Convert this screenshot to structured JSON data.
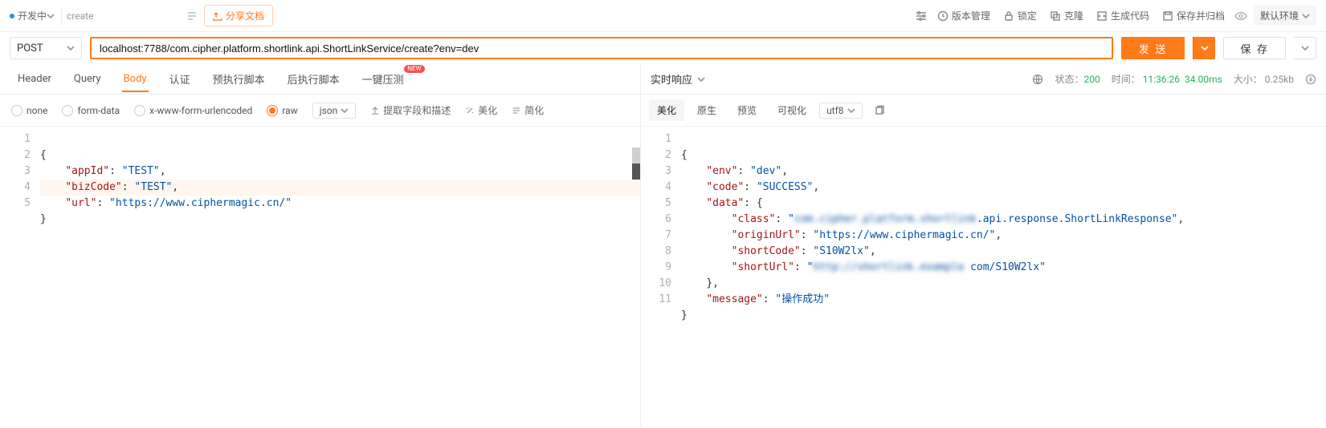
{
  "topbar": {
    "status_label": "开发中",
    "tab_name": "create",
    "share_label": "分享文档",
    "actions": {
      "version": "版本管理",
      "lock": "锁定",
      "clone": "克隆",
      "gencode": "生成代码",
      "saveArchive": "保存并归档"
    },
    "env": "默认环境"
  },
  "request": {
    "method": "POST",
    "url": "localhost:7788/com.cipher.platform.shortlink.api.ShortLinkService/create?env=dev",
    "send_label": "发 送",
    "save_label": "保 存"
  },
  "reqTabs": {
    "header": "Header",
    "query": "Query",
    "body": "Body",
    "auth": "认证",
    "pre": "预执行脚本",
    "post": "后执行脚本",
    "load": "一键压测",
    "new_badge": "NEW"
  },
  "bodyOpts": {
    "none": "none",
    "formdata": "form-data",
    "urlenc": "x-www-form-urlencoded",
    "raw": "raw",
    "contentType": "json",
    "extract": "提取字段和描述",
    "beautify": "美化",
    "simplify": "简化"
  },
  "requestBody": {
    "lines": [
      "1",
      "2",
      "3",
      "4",
      "5"
    ],
    "k_appId": "\"appId\"",
    "v_appId": "\"TEST\"",
    "k_bizCode": "\"bizCode\"",
    "v_bizCode": "\"TEST\"",
    "k_url": "\"url\"",
    "v_url": "\"https://www.ciphermagic.cn/\""
  },
  "response": {
    "title": "实时响应",
    "status_label": "状态：",
    "status_code": "200",
    "time_label": "时间：",
    "time_clock": "11:36:26",
    "time_dur": "34.00ms",
    "size_label": "大小：",
    "size": "0.25kb",
    "tabs": {
      "beautify": "美化",
      "raw": "原生",
      "preview": "预览",
      "visual": "可视化",
      "enc": "utf8"
    }
  },
  "responseBody": {
    "lines": [
      "1",
      "2",
      "3",
      "4",
      "5",
      "6",
      "7",
      "8",
      "9",
      "10",
      "11"
    ],
    "k_env": "\"env\"",
    "v_env": "\"dev\"",
    "k_code": "\"code\"",
    "v_code": "\"SUCCESS\"",
    "k_data": "\"data\"",
    "k_class": "\"class\"",
    "v_class_a": "\"",
    "v_class_blur": "com.cipher.platform.shortlink",
    "v_class_b": ".api.response.ShortLinkResponse\"",
    "k_origin": "\"originUrl\"",
    "v_origin": "\"https://www.ciphermagic.cn/\"",
    "k_short": "\"shortCode\"",
    "v_short": "\"S10W2lx\"",
    "k_surl": "\"shortUrl\"",
    "v_surl_a": "\"",
    "v_surl_blur": "http://shortlink.example",
    "v_surl_b": " com/S10W2lx\"",
    "k_msg": "\"message\"",
    "v_msg": "\"操作成功\""
  }
}
